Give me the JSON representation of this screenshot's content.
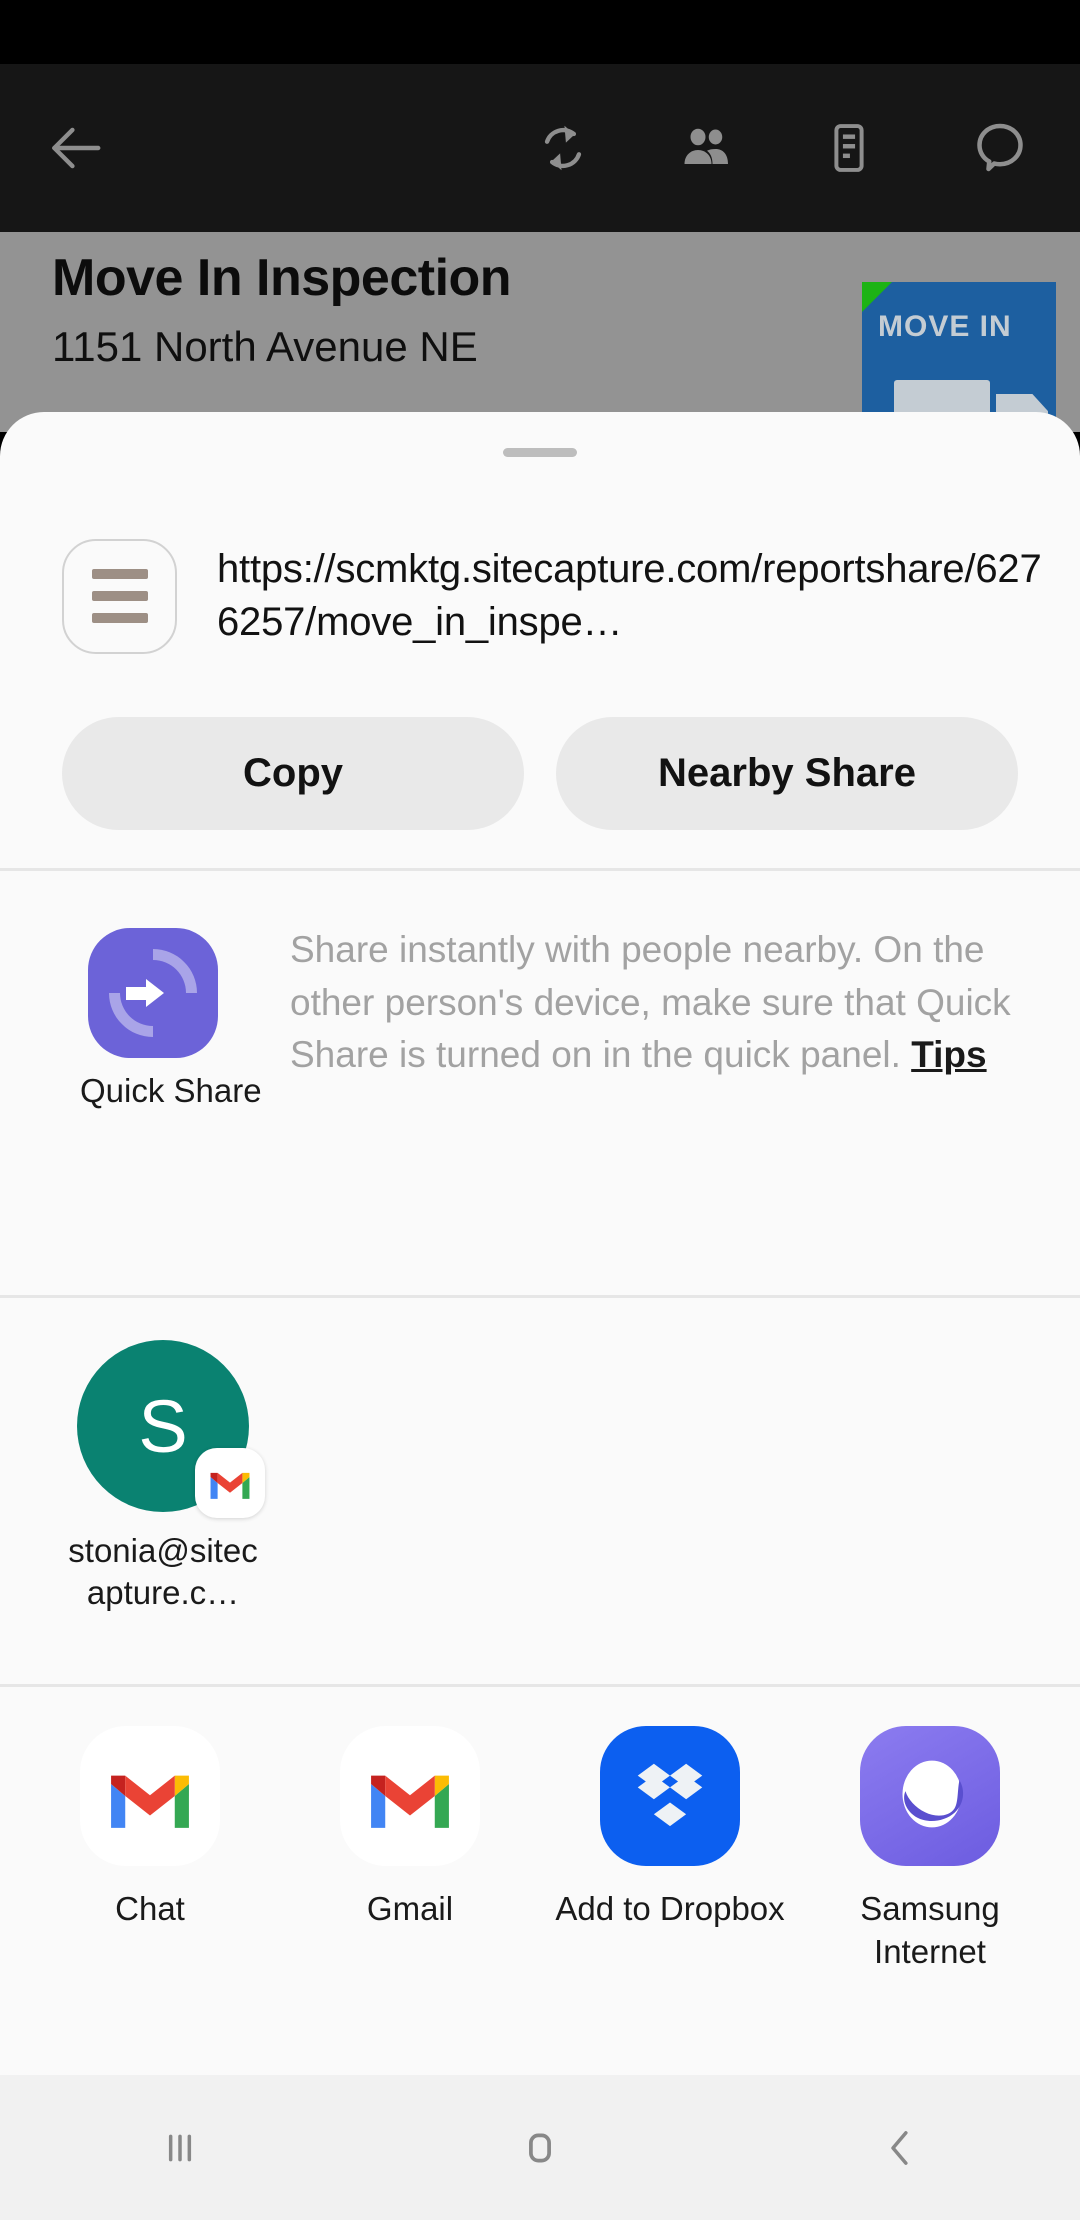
{
  "app_toolbar": {
    "back_icon": "back-arrow-icon",
    "actions": [
      {
        "name": "sync-icon",
        "label": "Sync"
      },
      {
        "name": "people-icon",
        "label": "People"
      },
      {
        "name": "report-icon",
        "label": "Report"
      },
      {
        "name": "comment-icon",
        "label": "Comments"
      }
    ]
  },
  "report": {
    "title": "Move In Inspection",
    "address": "1151 North Avenue NE",
    "thumbnail_text": "MOVE IN"
  },
  "share_sheet": {
    "url": "https://scmktg.sitecapture.com/reportshare/6276257/move_in_inspe…",
    "link_icon": "link-lines-icon",
    "actions": [
      {
        "name": "copy-button",
        "label": "Copy"
      },
      {
        "name": "nearby-share-button",
        "label": "Nearby Share"
      }
    ],
    "quick_share": {
      "title": "Quick Share",
      "description": "Share instantly with people nearby. On the other person's device, make sure that Quick Share is turned on in the quick panel. ",
      "link_label": "Tips",
      "icon_color": "#6c63d8"
    },
    "contacts": [
      {
        "initial": "S",
        "name": "stonia@sitecapture.c…",
        "avatar_color": "#0a8271",
        "badge_app": "gmail-icon"
      }
    ],
    "apps": [
      {
        "label": "Chat",
        "icon": "gmail-icon",
        "icon_style": "white"
      },
      {
        "label": "Gmail",
        "icon": "gmail-icon",
        "icon_style": "white"
      },
      {
        "label": "Add to Dropbox",
        "icon": "dropbox-icon",
        "icon_style": "dropbox"
      },
      {
        "label": "Samsung Internet",
        "icon": "samsung-internet-icon",
        "icon_style": "sbrowser"
      }
    ]
  },
  "navbar": {
    "recents": "recents-icon",
    "home": "home-icon",
    "back": "back-icon"
  }
}
